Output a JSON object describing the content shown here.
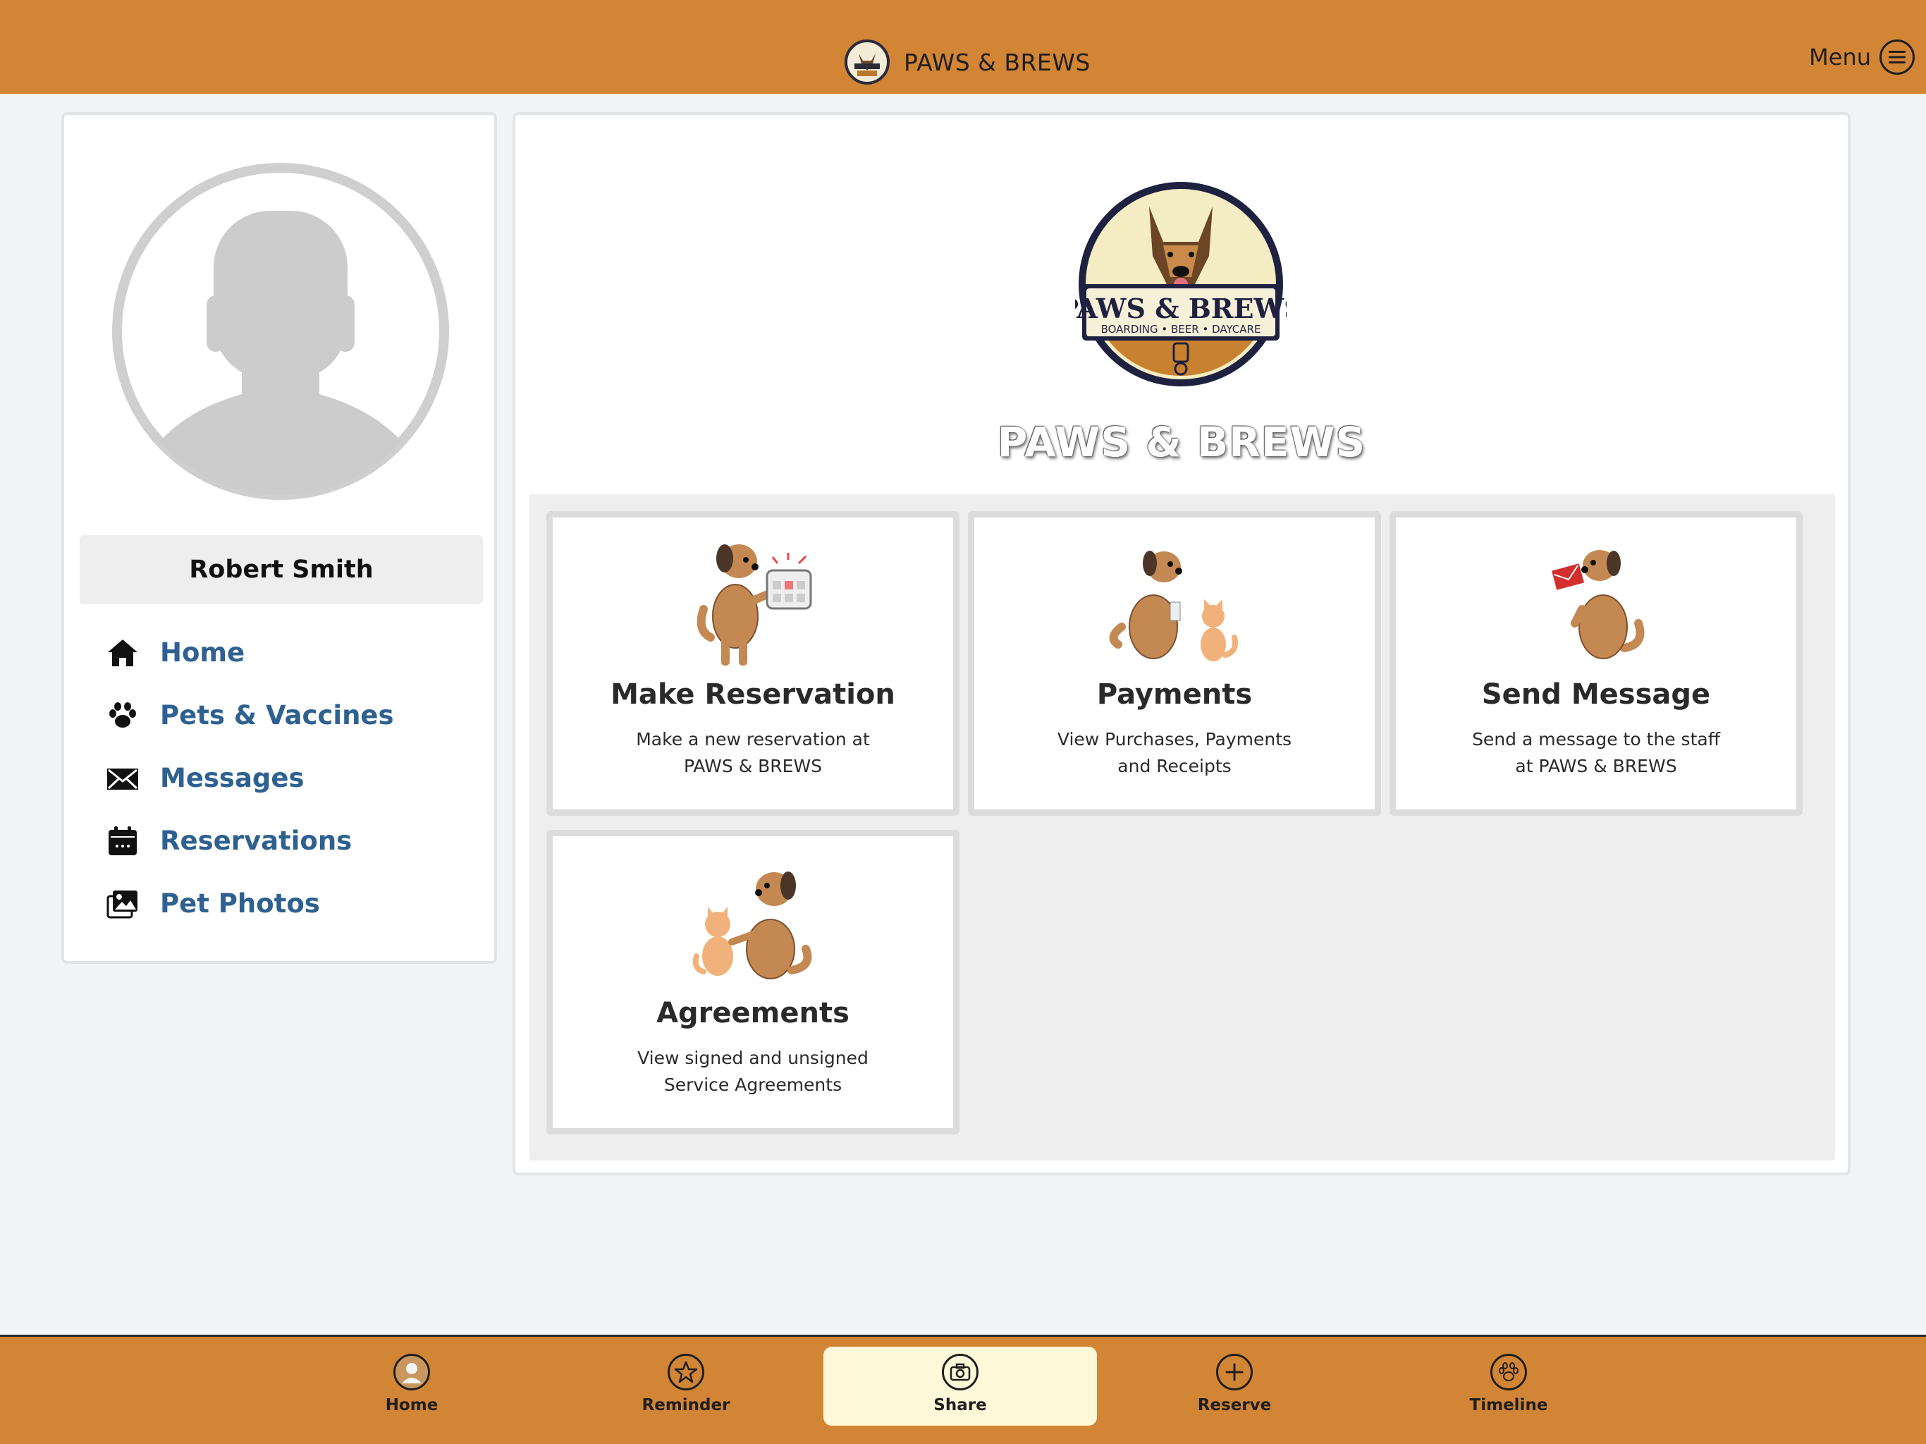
{
  "header": {
    "brand_title": "PAWS & BREWS",
    "menu_label": "Menu"
  },
  "sidebar": {
    "user_name": "Robert Smith",
    "items": [
      {
        "label": "Home",
        "icon": "home-icon"
      },
      {
        "label": "Pets & Vaccines",
        "icon": "paw-icon"
      },
      {
        "label": "Messages",
        "icon": "envelope-icon"
      },
      {
        "label": "Reservations",
        "icon": "calendar-icon"
      },
      {
        "label": "Pet Photos",
        "icon": "photos-icon"
      }
    ]
  },
  "main": {
    "logo": {
      "line1": "PAWS & BREWS",
      "line2": "BOARDING • BEER • DAYCARE"
    },
    "title": "PAWS & BREWS",
    "tiles": [
      {
        "title": "Make Reservation",
        "desc_line1": "Make a new reservation at",
        "desc_line2": "PAWS & BREWS"
      },
      {
        "title": "Payments",
        "desc_line1": "View Purchases, Payments",
        "desc_line2": "and Receipts"
      },
      {
        "title": "Send Message",
        "desc_line1": "Send a message to the staff",
        "desc_line2": "at PAWS & BREWS"
      },
      {
        "title": "Agreements",
        "desc_line1": "View signed and unsigned",
        "desc_line2": "Service Agreements"
      }
    ]
  },
  "bottom_nav": {
    "tabs": [
      {
        "label": "Home",
        "icon": "user-icon"
      },
      {
        "label": "Reminder",
        "icon": "star-icon"
      },
      {
        "label": "Share",
        "icon": "camera-icon",
        "active": true
      },
      {
        "label": "Reserve",
        "icon": "plus-icon"
      },
      {
        "label": "Timeline",
        "icon": "paw-icon"
      }
    ]
  },
  "colors": {
    "brand_orange": "#d38536",
    "nav_link": "#2e6190",
    "active_tab": "#fef8d9",
    "page_bg": "#f1f5f8"
  }
}
